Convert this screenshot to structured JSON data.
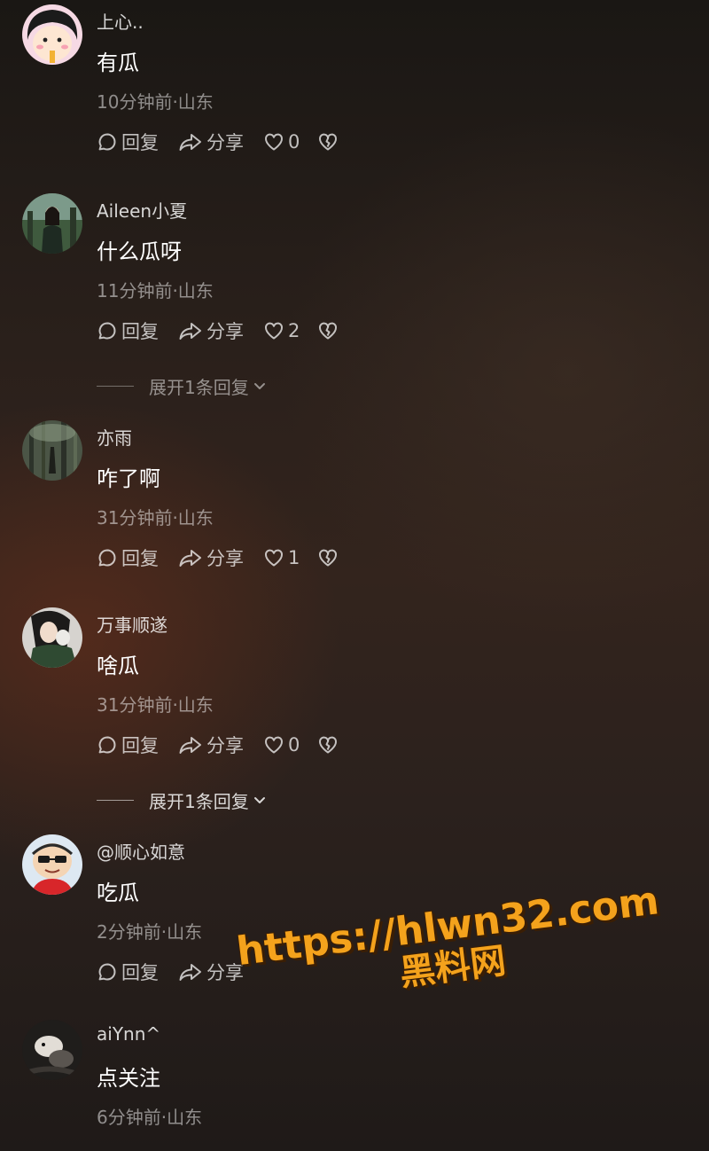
{
  "colors": {
    "watermark": "#f4a21c",
    "text_primary": "#ffffff",
    "text_secondary": "rgba(255,255,255,0.5)"
  },
  "actions": {
    "reply_label": "回复",
    "share_label": "分享",
    "reply_icon": "comment-bubble-icon",
    "share_icon": "share-arrow-icon",
    "like_icon": "heart-icon",
    "dislike_icon": "broken-heart-icon"
  },
  "comments": [
    {
      "username": "上心..",
      "content": "有瓜",
      "meta": "10分钟前·山东",
      "likes": "0"
    },
    {
      "username": "Aileen小夏",
      "content": "什么瓜呀",
      "meta": "11分钟前·山东",
      "likes": "2",
      "expand": "展开1条回复"
    },
    {
      "username": "亦雨",
      "content": "咋了啊",
      "meta": "31分钟前·山东",
      "likes": "1"
    },
    {
      "username": "万事顺遂",
      "content": "啥瓜",
      "meta": "31分钟前·山东",
      "likes": "0",
      "expand": "展开1条回复"
    },
    {
      "username": "@顺心如意",
      "content": "吃瓜",
      "meta": "2分钟前·山东"
    },
    {
      "username": "aiYnn^",
      "content": "点关注",
      "meta": "6分钟前·山东"
    }
  ],
  "watermark": {
    "url": "https://hlwn32.com",
    "name": "黑料网"
  }
}
